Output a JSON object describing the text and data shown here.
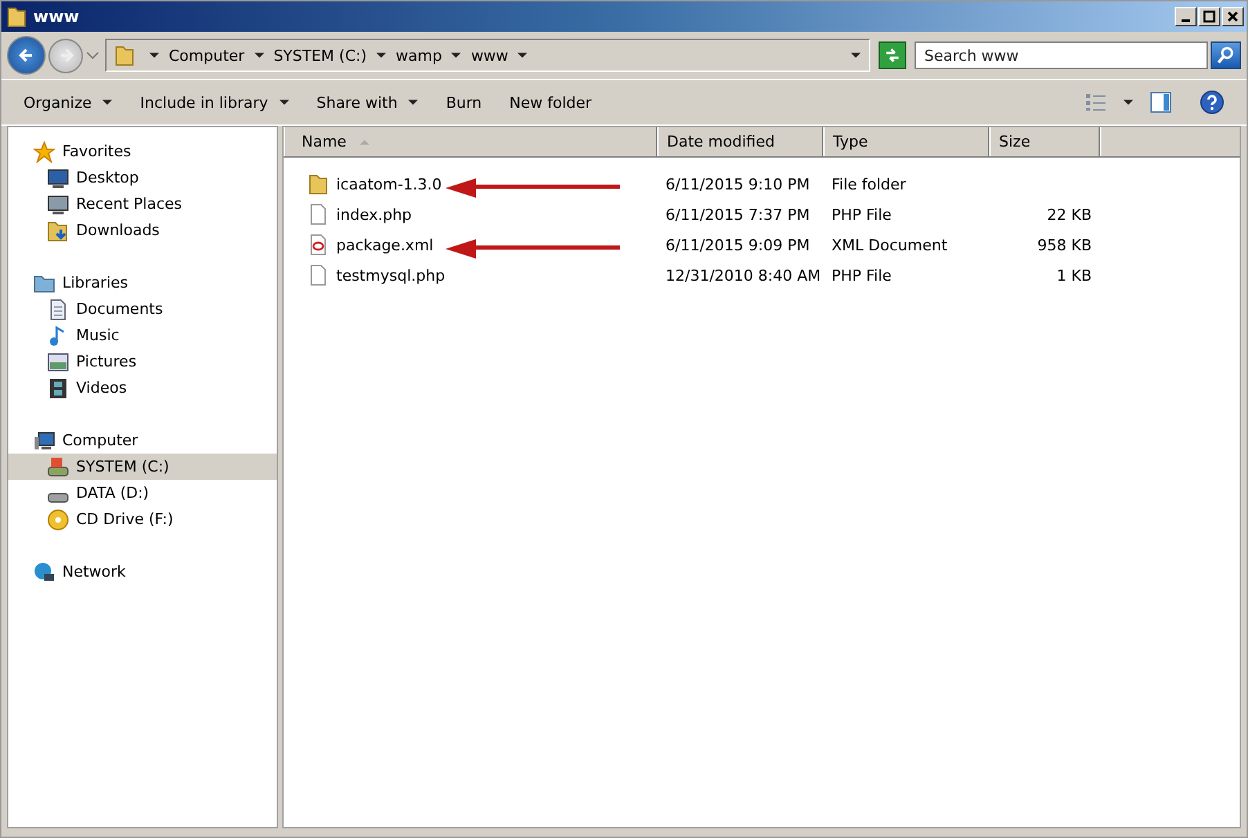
{
  "window": {
    "title": "www"
  },
  "address": {
    "crumbs": [
      "Computer",
      "SYSTEM (C:)",
      "wamp",
      "www"
    ]
  },
  "search": {
    "placeholder": "Search www"
  },
  "toolbar": [
    {
      "label": "Organize",
      "dropdown": true
    },
    {
      "label": "Include in library",
      "dropdown": true
    },
    {
      "label": "Share with",
      "dropdown": true
    },
    {
      "label": "Burn",
      "dropdown": false
    },
    {
      "label": "New folder",
      "dropdown": false
    }
  ],
  "sidebar": {
    "groups": [
      {
        "label": "Favorites",
        "kind": "star",
        "items": [
          {
            "label": "Desktop",
            "kind": "desktop",
            "selected": false
          },
          {
            "label": "Recent Places",
            "kind": "recent",
            "selected": false
          },
          {
            "label": "Downloads",
            "kind": "downloads",
            "selected": false
          }
        ]
      },
      {
        "label": "Libraries",
        "kind": "library",
        "items": [
          {
            "label": "Documents",
            "kind": "document",
            "selected": false
          },
          {
            "label": "Music",
            "kind": "music",
            "selected": false
          },
          {
            "label": "Pictures",
            "kind": "pictures",
            "selected": false
          },
          {
            "label": "Videos",
            "kind": "videos",
            "selected": false
          }
        ]
      },
      {
        "label": "Computer",
        "kind": "computer",
        "items": [
          {
            "label": "SYSTEM (C:)",
            "kind": "sysdrive",
            "selected": true
          },
          {
            "label": "DATA (D:)",
            "kind": "drive",
            "selected": false
          },
          {
            "label": "CD Drive (F:)",
            "kind": "cd",
            "selected": false
          }
        ]
      },
      {
        "label": "Network",
        "kind": "network"
      }
    ]
  },
  "table": {
    "columns": [
      "Name",
      "Date modified",
      "Type",
      "Size"
    ],
    "rows": [
      {
        "name": "icaatom-1.3.0",
        "date": "6/11/2015 9:10 PM",
        "type": "File folder",
        "kind": "folder",
        "arrow": true
      },
      {
        "name": "index.php",
        "date": "6/11/2015 7:37 PM",
        "type": "PHP File",
        "size": "22 KB",
        "kind": "file",
        "arrow": false
      },
      {
        "name": "package.xml",
        "date": "6/11/2015 9:09 PM",
        "type": "XML Document",
        "size": "958 KB",
        "kind": "xml",
        "arrow": true
      },
      {
        "name": "testmysql.php",
        "date": "12/31/2010 8:40 AM",
        "type": "PHP File",
        "size": "1 KB",
        "kind": "file",
        "arrow": false
      }
    ]
  }
}
